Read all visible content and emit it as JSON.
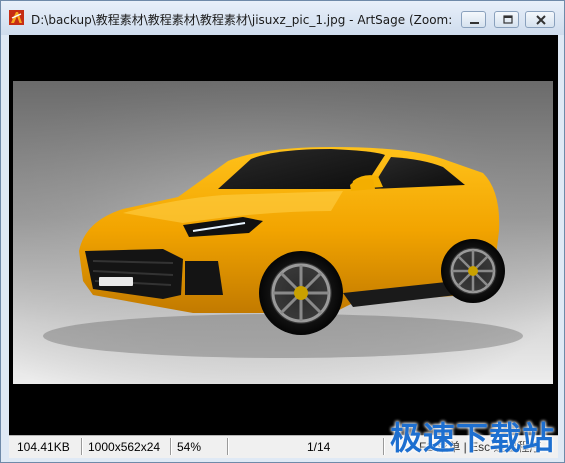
{
  "window": {
    "title": "D:\\backup\\教程素材\\教程素材\\教程素材\\jisuxz_pic_1.jpg - ArtSage (Zoom:",
    "buttons": {
      "minimize": "minimize-icon",
      "restore": "restore-icon",
      "close": "close-icon"
    }
  },
  "image": {
    "subject": "car-photo",
    "bg_color": "#000000"
  },
  "statusbar": {
    "file_size": "104.41KB",
    "dimensions": "1000x562x24",
    "zoom": "54%",
    "page": "1/14",
    "hint": "F1 菜单 | Esc 退出程序"
  },
  "watermark": {
    "text": "极速下载站"
  },
  "colors": {
    "title_bg": "#dfe9f5",
    "accent": "#1d6fd0"
  }
}
